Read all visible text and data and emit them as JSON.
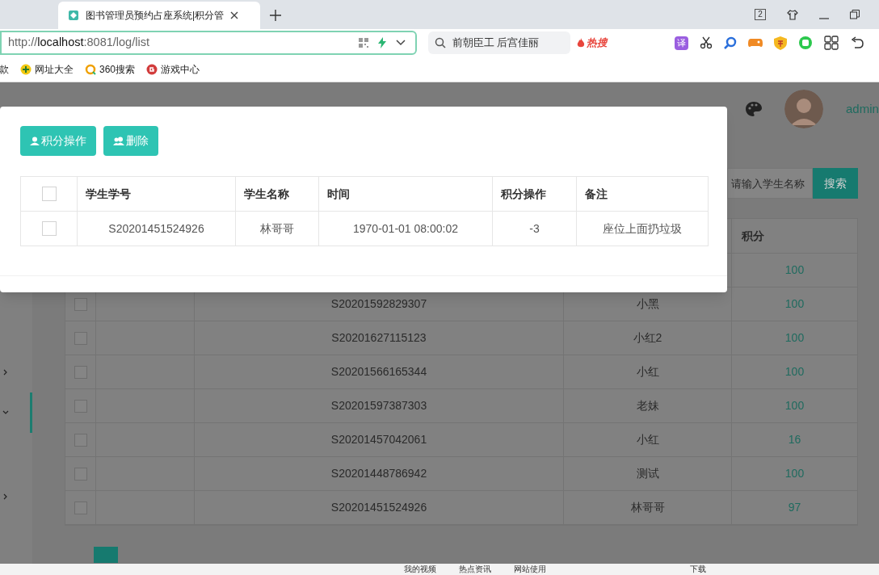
{
  "browser": {
    "tab_title": "图书管理员预约占座系统|积分管",
    "tab_count": "2",
    "url_prefix": "http://",
    "url_host": "localhost",
    "url_rest": ":8081/log/list",
    "search_value": "前朝臣工 后宫佳丽",
    "hot_label": "热搜",
    "translate_label": "译",
    "bookmarks": [
      {
        "kind": "plain",
        "label": "款"
      },
      {
        "kind": "web",
        "label": "网址大全"
      },
      {
        "kind": "so",
        "label": "360搜索"
      },
      {
        "kind": "game",
        "label": "游戏中心"
      }
    ]
  },
  "page": {
    "user_name": "admin",
    "search": {
      "placeholder": "请输入学生名称",
      "button": "搜索"
    },
    "score_column": "积分",
    "rows": [
      {
        "score": "100"
      },
      {
        "checked": false,
        "student_no": "S20201592829307",
        "name": "小黑",
        "score": "100"
      },
      {
        "checked": false,
        "student_no": "S20201627115123",
        "name": "小红2",
        "score": "100"
      },
      {
        "checked": false,
        "student_no": "S20201566165344",
        "name": "小红",
        "score": "100"
      },
      {
        "checked": false,
        "student_no": "S20201597387303",
        "name": "老妹",
        "score": "100"
      },
      {
        "checked": false,
        "student_no": "S20201457042061",
        "name": "小红",
        "score": "16"
      },
      {
        "checked": false,
        "student_no": "S20201448786942",
        "name": "测试",
        "score": "100"
      },
      {
        "checked": false,
        "student_no": "S20201451524926",
        "name": "林哥哥",
        "score": "97"
      }
    ],
    "sidebar": [
      {
        "expanded": false,
        "selected": false
      },
      {
        "expanded": true,
        "selected": true
      },
      {
        "expanded": false,
        "selected": false
      }
    ]
  },
  "modal": {
    "buttons": [
      {
        "kind": "score",
        "label": "积分操作"
      },
      {
        "kind": "delete",
        "label": "删除"
      }
    ],
    "select_all_checked": false,
    "columns": [
      "学生学号",
      "学生名称",
      "时间",
      "积分操作",
      "备注"
    ],
    "rows": [
      {
        "checked": false,
        "cells": [
          "S20201451524926",
          "林哥哥",
          "1970-01-01 08:00:02",
          "-3",
          "座位上面扔垃圾"
        ]
      }
    ]
  },
  "status_bar": [
    "我的视频",
    "热点资讯",
    "网站使用",
    "下载"
  ]
}
